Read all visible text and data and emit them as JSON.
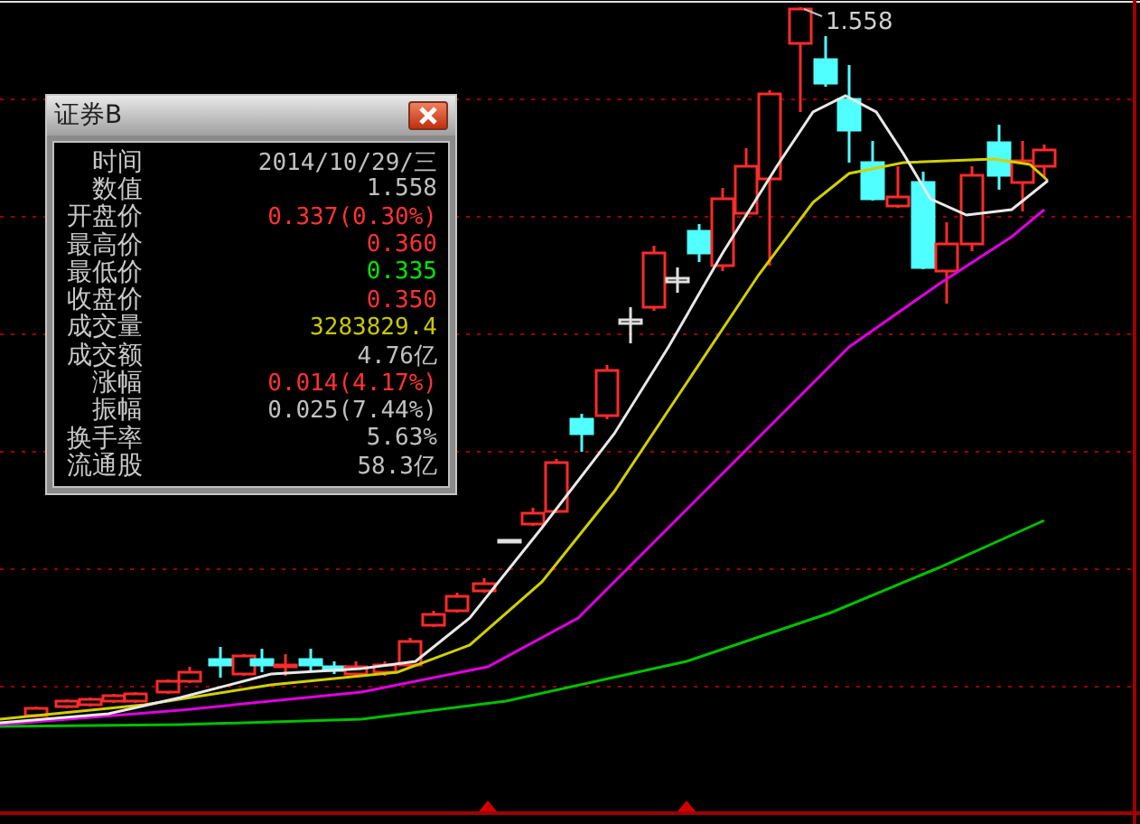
{
  "chart": {
    "peak_label": "1.558"
  },
  "popup": {
    "title": "证券B",
    "rows": [
      {
        "label": "时间",
        "value": "2014/10/29/三",
        "color": "#c0c0c0"
      },
      {
        "label": "数值",
        "value": "1.558",
        "color": "#c0c0c0"
      },
      {
        "label": "开盘价",
        "value": "0.337(0.30%)",
        "color": "#ff3232"
      },
      {
        "label": "最高价",
        "value": "0.360",
        "color": "#ff3232"
      },
      {
        "label": "最低价",
        "value": "0.335",
        "color": "#00e600"
      },
      {
        "label": "收盘价",
        "value": "0.350",
        "color": "#ff3232"
      },
      {
        "label": "成交量",
        "value": "3283829.4",
        "color": "#c8c800"
      },
      {
        "label": "成交额",
        "value": "4.76亿",
        "color": "#c0c0c0"
      },
      {
        "label": "涨幅",
        "value": "0.014(4.17%)",
        "color": "#ff3232"
      },
      {
        "label": "振幅",
        "value": "0.025(7.44%)",
        "color": "#c0c0c0"
      },
      {
        "label": "换手率",
        "value": "5.63%",
        "color": "#c0c0c0"
      },
      {
        "label": "流通股",
        "value": "58.3亿",
        "color": "#c0c0c0"
      }
    ]
  }
}
